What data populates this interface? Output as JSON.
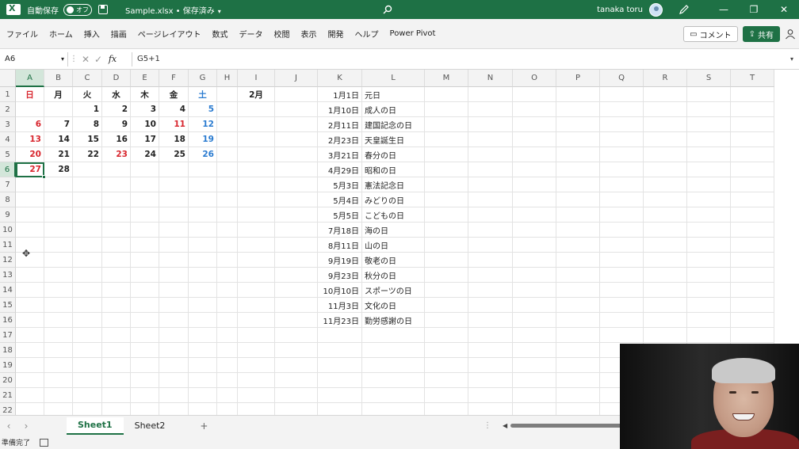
{
  "titlebar": {
    "autosave_label": "自動保存",
    "autosave_state": "オフ",
    "doc_title": "Sample.xlsx • 保存済み",
    "user_name": "tanaka toru",
    "accent": "#1e7145"
  },
  "ribbon": {
    "tabs": [
      "ファイル",
      "ホーム",
      "挿入",
      "描画",
      "ページレイアウト",
      "数式",
      "データ",
      "校閲",
      "表示",
      "開発",
      "ヘルプ",
      "Power Pivot"
    ],
    "comment_label": "コメント",
    "share_label": "共有"
  },
  "formula_bar": {
    "name_box": "A6",
    "fx": "fx",
    "formula": "G5+1"
  },
  "grid": {
    "columns": [
      "A",
      "B",
      "C",
      "D",
      "E",
      "F",
      "G",
      "H",
      "I",
      "J",
      "K",
      "L",
      "M",
      "N",
      "O",
      "P",
      "Q",
      "R",
      "S",
      "T"
    ],
    "selected_column": "A",
    "selected_row": 6,
    "rows": [
      "1",
      "2",
      "3",
      "4",
      "5",
      "6",
      "7",
      "8",
      "9",
      "10",
      "11",
      "12",
      "13",
      "14",
      "15",
      "16",
      "17",
      "18",
      "19",
      "20",
      "21",
      "22"
    ],
    "weekday_headers": [
      "日",
      "月",
      "火",
      "水",
      "木",
      "金",
      "土"
    ],
    "month_label": "2月",
    "calendar": [
      [
        "",
        "",
        "1",
        "2",
        "3",
        "4",
        "5"
      ],
      [
        "6",
        "7",
        "8",
        "9",
        "10",
        "11",
        "12"
      ],
      [
        "13",
        "14",
        "15",
        "16",
        "17",
        "18",
        "19"
      ],
      [
        "20",
        "21",
        "22",
        "23",
        "24",
        "25",
        "26"
      ],
      [
        "27",
        "28",
        "",
        "",
        "",
        "",
        ""
      ]
    ],
    "holidays": [
      {
        "date": "1月1日",
        "name": "元日"
      },
      {
        "date": "1月10日",
        "name": "成人の日"
      },
      {
        "date": "2月11日",
        "name": "建国記念の日"
      },
      {
        "date": "2月23日",
        "name": "天皇誕生日"
      },
      {
        "date": "3月21日",
        "name": "春分の日"
      },
      {
        "date": "4月29日",
        "name": "昭和の日"
      },
      {
        "date": "5月3日",
        "name": "憲法記念日"
      },
      {
        "date": "5月4日",
        "name": "みどりの日"
      },
      {
        "date": "5月5日",
        "name": "こどもの日"
      },
      {
        "date": "7月18日",
        "name": "海の日"
      },
      {
        "date": "8月11日",
        "name": "山の日"
      },
      {
        "date": "9月19日",
        "name": "敬老の日"
      },
      {
        "date": "9月23日",
        "name": "秋分の日"
      },
      {
        "date": "10月10日",
        "name": "スポーツの日"
      },
      {
        "date": "11月3日",
        "name": "文化の日"
      },
      {
        "date": "11月23日",
        "name": "勤労感謝の日"
      }
    ],
    "colors": {
      "sunday_red": "#d8262e",
      "saturday_blue": "#2a7bd0"
    }
  },
  "sheets": {
    "tabs": [
      "Sheet1",
      "Sheet2"
    ],
    "active": "Sheet1",
    "add_label": "+"
  },
  "status": {
    "text": "準備完了"
  },
  "icons": {
    "search": "search-icon",
    "pen": "pen-icon",
    "save": "save-icon",
    "comment": "comment-icon",
    "share": "share-icon",
    "person": "person-icon"
  }
}
